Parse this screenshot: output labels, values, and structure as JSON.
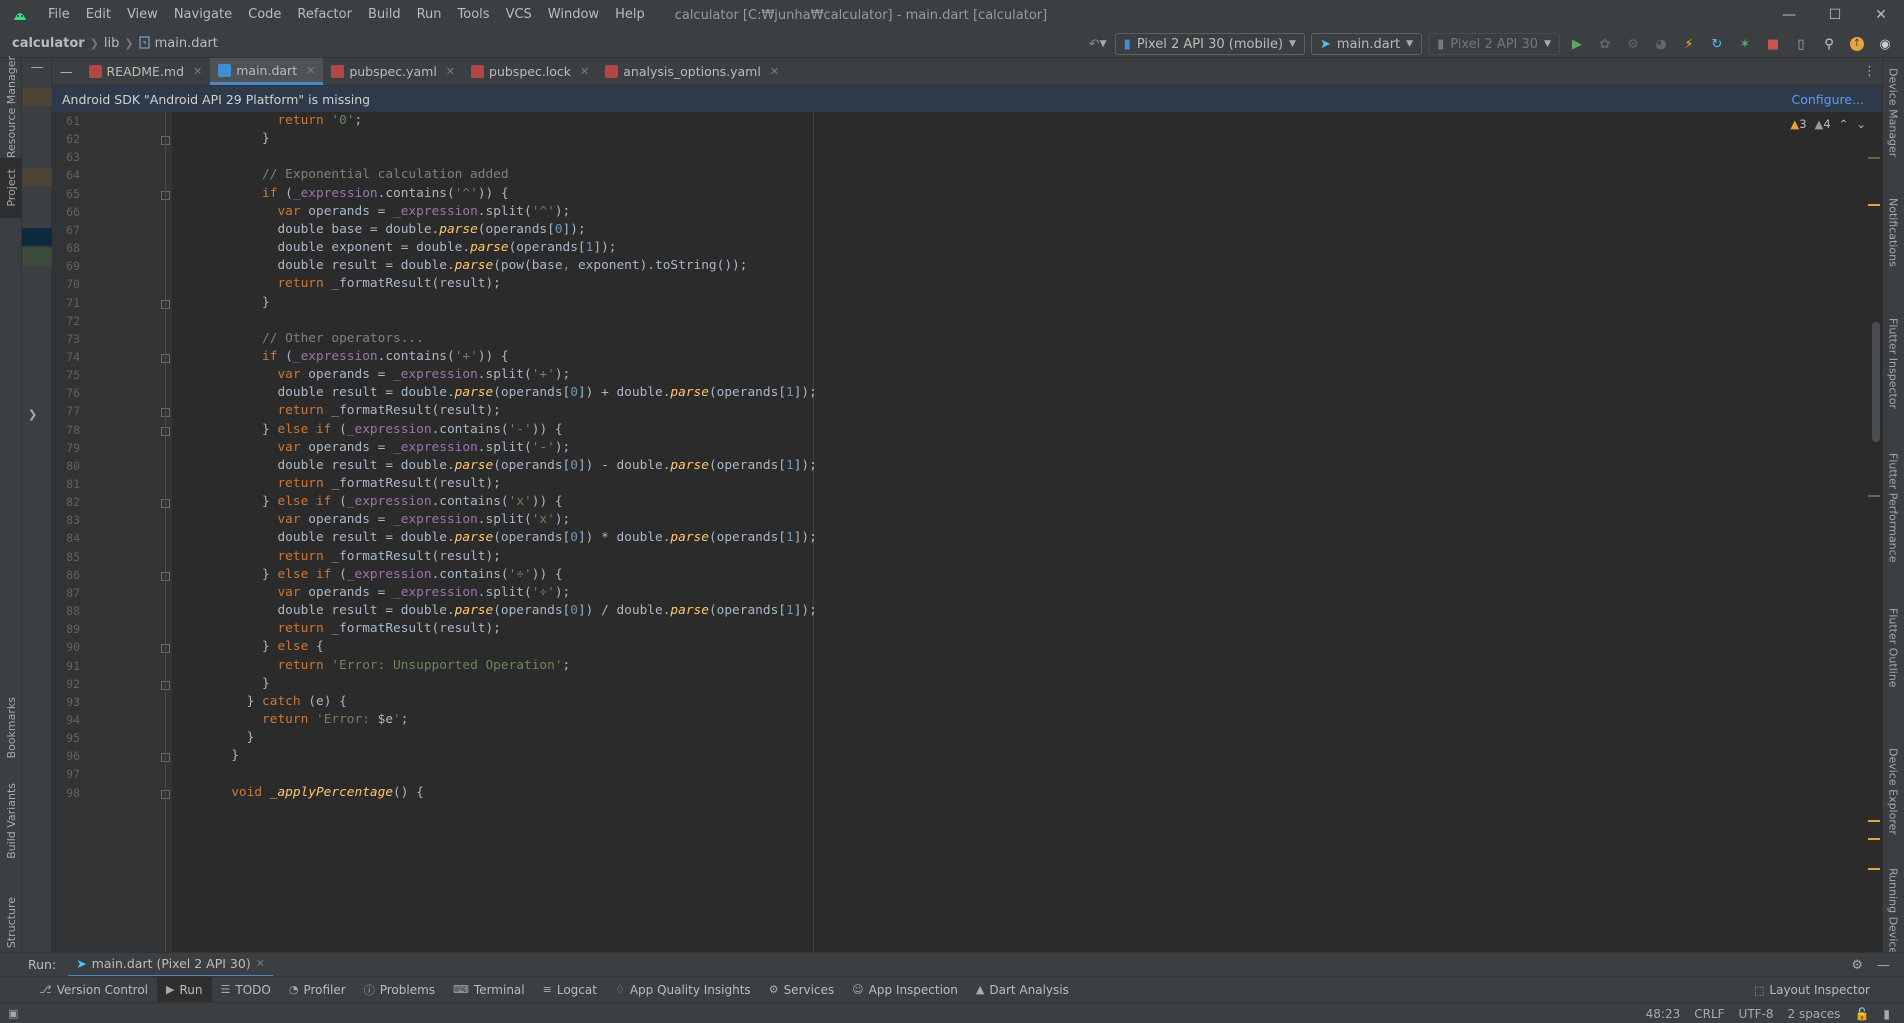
{
  "title_bar": {
    "menus": [
      "File",
      "Edit",
      "View",
      "Navigate",
      "Code",
      "Refactor",
      "Build",
      "Run",
      "Tools",
      "VCS",
      "Window",
      "Help"
    ],
    "window_title": "calculator [C:₩junha₩calculator] - main.dart [calculator]"
  },
  "breadcrumb": {
    "project": "calculator",
    "folder": "lib",
    "file": "main.dart"
  },
  "toolbar": {
    "device": "Pixel 2 API 30 (mobile)",
    "run_config": "main.dart",
    "avd": "Pixel 2 API 30"
  },
  "left_tools": {
    "resource_manager": "Resource Manager",
    "project": "Project",
    "bookmarks": "Bookmarks",
    "build_variants": "Build Variants",
    "structure": "Structure"
  },
  "right_tools": {
    "device_manager": "Device Manager",
    "notifications": "Notifications",
    "flutter_inspector": "Flutter Inspector",
    "flutter_performance": "Flutter Performance",
    "flutter_outline": "Flutter Outline",
    "device_explorer": "Device Explorer",
    "running_devices": "Running Devices"
  },
  "editor_tabs": [
    {
      "label": "README.md",
      "color": "#b34747"
    },
    {
      "label": "main.dart",
      "color": "#3f8ed6",
      "active": true
    },
    {
      "label": "pubspec.yaml",
      "color": "#b34747"
    },
    {
      "label": "pubspec.lock",
      "color": "#b34747"
    },
    {
      "label": "analysis_options.yaml",
      "color": "#b34747"
    }
  ],
  "banner": {
    "message": "Android SDK \"Android API 29 Platform\" is missing",
    "action": "Configure..."
  },
  "inspections": {
    "warnings": "3",
    "weak_warnings": "4"
  },
  "code_lines": [
    {
      "n": "61",
      "tokens": [
        [
          "k",
          "            return "
        ],
        [
          "s",
          "'0'"
        ],
        [
          "",
          ";"
        ]
      ]
    },
    {
      "n": "62",
      "tokens": [
        [
          "",
          "          }"
        ]
      ]
    },
    {
      "n": "63",
      "tokens": []
    },
    {
      "n": "64",
      "tokens": [
        [
          "c",
          "          // Exponential calculation added"
        ]
      ]
    },
    {
      "n": "65",
      "tokens": [
        [
          "k",
          "          if "
        ],
        [
          "",
          "("
        ],
        [
          "f",
          "_expression"
        ],
        [
          "",
          ".contains("
        ],
        [
          "s",
          "'^'"
        ],
        [
          "",
          ")) {"
        ]
      ]
    },
    {
      "n": "66",
      "tokens": [
        [
          "k",
          "            var "
        ],
        [
          "",
          "operands = "
        ],
        [
          "f",
          "_expression"
        ],
        [
          "",
          ".split("
        ],
        [
          "s",
          "'^'"
        ],
        [
          "",
          ");"
        ]
      ]
    },
    {
      "n": "67",
      "tokens": [
        [
          "",
          "            double base = double."
        ],
        [
          "fn",
          "parse"
        ],
        [
          "",
          "(operands["
        ],
        [
          "n",
          "0"
        ],
        [
          "",
          "]);"
        ]
      ]
    },
    {
      "n": "68",
      "tokens": [
        [
          "",
          "            double exponent = double."
        ],
        [
          "fn",
          "parse"
        ],
        [
          "",
          "(operands["
        ],
        [
          "n",
          "1"
        ],
        [
          "",
          "]);"
        ]
      ]
    },
    {
      "n": "69",
      "tokens": [
        [
          "",
          "            double result = double."
        ],
        [
          "fn",
          "parse"
        ],
        [
          "",
          "(pow(base"
        ],
        [
          "k",
          ","
        ],
        [
          "",
          " exponent).toString());"
        ]
      ]
    },
    {
      "n": "70",
      "tokens": [
        [
          "k",
          "            return "
        ],
        [
          "",
          "_formatResult(result);"
        ]
      ]
    },
    {
      "n": "71",
      "tokens": [
        [
          "",
          "          }"
        ]
      ]
    },
    {
      "n": "72",
      "tokens": []
    },
    {
      "n": "73",
      "tokens": [
        [
          "c",
          "          // Other operators..."
        ]
      ]
    },
    {
      "n": "74",
      "tokens": [
        [
          "k",
          "          if "
        ],
        [
          "",
          "("
        ],
        [
          "f",
          "_expression"
        ],
        [
          "",
          ".contains("
        ],
        [
          "s",
          "'+'"
        ],
        [
          "",
          ")) {"
        ]
      ]
    },
    {
      "n": "75",
      "tokens": [
        [
          "k",
          "            var "
        ],
        [
          "",
          "operands = "
        ],
        [
          "f",
          "_expression"
        ],
        [
          "",
          ".split("
        ],
        [
          "s",
          "'+'"
        ],
        [
          "",
          ");"
        ]
      ]
    },
    {
      "n": "76",
      "tokens": [
        [
          "",
          "            double result = double."
        ],
        [
          "fn",
          "parse"
        ],
        [
          "",
          "(operands["
        ],
        [
          "n",
          "0"
        ],
        [
          "",
          "]) + double."
        ],
        [
          "fn",
          "parse"
        ],
        [
          "",
          "(operands["
        ],
        [
          "n",
          "1"
        ],
        [
          "",
          "]);"
        ]
      ]
    },
    {
      "n": "77",
      "tokens": [
        [
          "k",
          "            return "
        ],
        [
          "",
          "_formatResult(result);"
        ]
      ]
    },
    {
      "n": "78",
      "tokens": [
        [
          "",
          "          } "
        ],
        [
          "k",
          "else if "
        ],
        [
          "",
          "("
        ],
        [
          "f",
          "_expression"
        ],
        [
          "",
          ".contains("
        ],
        [
          "s",
          "'-'"
        ],
        [
          "",
          ")) {"
        ]
      ]
    },
    {
      "n": "79",
      "tokens": [
        [
          "k",
          "            var "
        ],
        [
          "",
          "operands = "
        ],
        [
          "f",
          "_expression"
        ],
        [
          "",
          ".split("
        ],
        [
          "s",
          "'-'"
        ],
        [
          "",
          ");"
        ]
      ]
    },
    {
      "n": "80",
      "tokens": [
        [
          "",
          "            double result = double."
        ],
        [
          "fn",
          "parse"
        ],
        [
          "",
          "(operands["
        ],
        [
          "n",
          "0"
        ],
        [
          "",
          "]) - double."
        ],
        [
          "fn",
          "parse"
        ],
        [
          "",
          "(operands["
        ],
        [
          "n",
          "1"
        ],
        [
          "",
          "]);"
        ]
      ]
    },
    {
      "n": "81",
      "tokens": [
        [
          "k",
          "            return "
        ],
        [
          "",
          "_formatResult(result);"
        ]
      ]
    },
    {
      "n": "82",
      "tokens": [
        [
          "",
          "          } "
        ],
        [
          "k",
          "else if "
        ],
        [
          "",
          "("
        ],
        [
          "f",
          "_expression"
        ],
        [
          "",
          ".contains("
        ],
        [
          "s",
          "'x'"
        ],
        [
          "",
          ")) {"
        ]
      ]
    },
    {
      "n": "83",
      "tokens": [
        [
          "k",
          "            var "
        ],
        [
          "",
          "operands = "
        ],
        [
          "f",
          "_expression"
        ],
        [
          "",
          ".split("
        ],
        [
          "s",
          "'x'"
        ],
        [
          "",
          ");"
        ]
      ]
    },
    {
      "n": "84",
      "tokens": [
        [
          "",
          "            double result = double."
        ],
        [
          "fn",
          "parse"
        ],
        [
          "",
          "(operands["
        ],
        [
          "n",
          "0"
        ],
        [
          "",
          "]) * double."
        ],
        [
          "fn",
          "parse"
        ],
        [
          "",
          "(operands["
        ],
        [
          "n",
          "1"
        ],
        [
          "",
          "]);"
        ]
      ]
    },
    {
      "n": "85",
      "tokens": [
        [
          "k",
          "            return "
        ],
        [
          "",
          "_formatResult(result);"
        ]
      ]
    },
    {
      "n": "86",
      "tokens": [
        [
          "",
          "          } "
        ],
        [
          "k",
          "else if "
        ],
        [
          "",
          "("
        ],
        [
          "f",
          "_expression"
        ],
        [
          "",
          ".contains("
        ],
        [
          "s",
          "'÷'"
        ],
        [
          "",
          ")) {"
        ]
      ]
    },
    {
      "n": "87",
      "tokens": [
        [
          "k",
          "            var "
        ],
        [
          "",
          "operands = "
        ],
        [
          "f",
          "_expression"
        ],
        [
          "",
          ".split("
        ],
        [
          "s",
          "'÷'"
        ],
        [
          "",
          ");"
        ]
      ]
    },
    {
      "n": "88",
      "tokens": [
        [
          "",
          "            double result = double."
        ],
        [
          "fn",
          "parse"
        ],
        [
          "",
          "(operands["
        ],
        [
          "n",
          "0"
        ],
        [
          "",
          "]) / double."
        ],
        [
          "fn",
          "parse"
        ],
        [
          "",
          "(operands["
        ],
        [
          "n",
          "1"
        ],
        [
          "",
          "]);"
        ]
      ]
    },
    {
      "n": "89",
      "tokens": [
        [
          "k",
          "            return "
        ],
        [
          "",
          "_formatResult(result);"
        ]
      ]
    },
    {
      "n": "90",
      "tokens": [
        [
          "",
          "          } "
        ],
        [
          "k",
          "else "
        ],
        [
          "",
          "{"
        ]
      ]
    },
    {
      "n": "91",
      "tokens": [
        [
          "k",
          "            return "
        ],
        [
          "s",
          "'Error: Unsupported Operation'"
        ],
        [
          "",
          ";"
        ]
      ]
    },
    {
      "n": "92",
      "tokens": [
        [
          "",
          "          }"
        ]
      ]
    },
    {
      "n": "93",
      "tokens": [
        [
          "",
          "        } "
        ],
        [
          "k",
          "catch "
        ],
        [
          "",
          "(e) {"
        ]
      ]
    },
    {
      "n": "94",
      "tokens": [
        [
          "k",
          "          return "
        ],
        [
          "s",
          "'Error: "
        ],
        [
          "",
          "$e"
        ],
        [
          "s",
          "'"
        ],
        [
          "",
          ";"
        ]
      ]
    },
    {
      "n": "95",
      "tokens": [
        [
          "",
          "        }"
        ]
      ]
    },
    {
      "n": "96",
      "tokens": [
        [
          "",
          "      }"
        ]
      ]
    },
    {
      "n": "97",
      "tokens": []
    },
    {
      "n": "98",
      "tokens": [
        [
          "k",
          "      void "
        ],
        [
          "fn",
          "_applyPercentage"
        ],
        [
          "",
          "() {"
        ]
      ]
    }
  ],
  "run_window": {
    "label": "Run:",
    "tab": "main.dart (Pixel 2 API 30)"
  },
  "bottom_tools": [
    "Version Control",
    "Run",
    "TODO",
    "Profiler",
    "Problems",
    "Terminal",
    "Logcat",
    "App Quality Insights",
    "Services",
    "App Inspection",
    "Dart Analysis"
  ],
  "layout_inspector": "Layout Inspector",
  "status": {
    "position": "48:23",
    "line_sep": "CRLF",
    "encoding": "UTF-8",
    "indent": "2 spaces"
  },
  "colors": {
    "accent": "#4a88c7",
    "keyword": "#cc7832",
    "string": "#6a8759",
    "comment": "#808080",
    "function": "#ffc66d",
    "field": "#9876aa",
    "number": "#6897bb"
  }
}
